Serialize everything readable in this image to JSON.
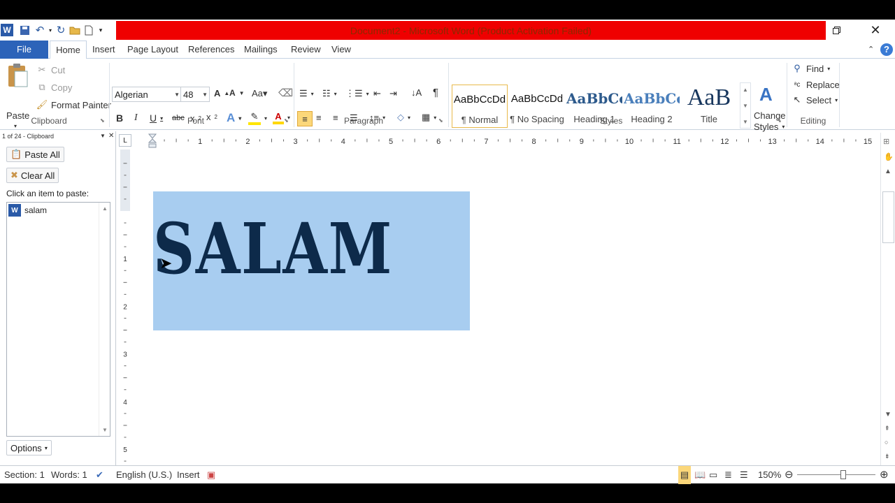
{
  "window": {
    "title": "Document2  -  Microsoft Word (Product Activation Failed)",
    "colors": {
      "title_bar": "#ef0000",
      "file_tab": "#2c63b9",
      "selection": "#a8cdf0",
      "text": "#0d2a4a"
    }
  },
  "tabs": [
    "File",
    "Home",
    "Insert",
    "Page Layout",
    "References",
    "Mailings",
    "Review",
    "View"
  ],
  "ribbon": {
    "clipboard": {
      "paste": "Paste",
      "cut": "Cut",
      "copy": "Copy",
      "format_painter": "Format Painter",
      "label": "Clipboard"
    },
    "font": {
      "name": "Algerian",
      "size": "48",
      "label": "Font"
    },
    "paragraph": {
      "label": "Paragraph"
    },
    "styles": {
      "label": "Styles",
      "items": [
        {
          "preview": "AaBbCcDd",
          "name": "¶ Normal"
        },
        {
          "preview": "AaBbCcDd",
          "name": "¶ No Spacing"
        },
        {
          "preview": "AaBbCc",
          "name": "Heading 1"
        },
        {
          "preview": "AaBbCc",
          "name": "Heading 2"
        },
        {
          "preview": "AaB",
          "name": "Title"
        }
      ],
      "change_styles": "Change",
      "change_styles_2": "Styles"
    },
    "editing": {
      "find": "Find",
      "replace": "Replace",
      "select": "Select",
      "label": "Editing"
    }
  },
  "ruler": {
    "corner": "L",
    "h_numbers": [
      "1",
      "2",
      "3",
      "4",
      "5",
      "6",
      "7",
      "8",
      "9",
      "10",
      "11",
      "12",
      "13",
      "14",
      "15"
    ],
    "v_numbers": [
      "1",
      "2",
      "3",
      "4",
      "5"
    ]
  },
  "clipboard_pane": {
    "header": "1 of 24 - Clipboard",
    "paste_all": "Paste All",
    "clear_all": "Clear All",
    "prompt": "Click an item to paste:",
    "items": [
      "salam"
    ],
    "options": "Options"
  },
  "document": {
    "text": "SALAM"
  },
  "status": {
    "section": "Section: 1",
    "words": "Words: 1",
    "language": "English (U.S.)",
    "mode": "Insert",
    "zoom": "150%"
  }
}
